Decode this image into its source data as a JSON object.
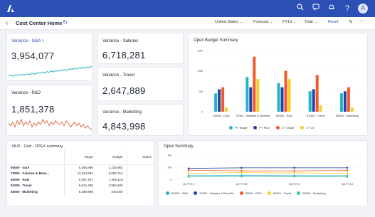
{
  "header": {
    "logo_icon": "anaplan-logo-icon",
    "icons": [
      "search-icon",
      "chat-icon",
      "bell-icon",
      "help-icon"
    ],
    "avatar_initials": "A"
  },
  "subbar": {
    "title": "Cost Center Home",
    "filters": [
      {
        "label": "United States"
      },
      {
        "label": "Forecast"
      },
      {
        "label": "FY19"
      },
      {
        "label": "Total"
      }
    ],
    "reset_label": "Reset"
  },
  "kpis": {
    "ga": {
      "title": "Variance - G&A >",
      "value": "3,954,077"
    },
    "rd": {
      "title": "Variance - R&D",
      "value": "1,851,378"
    },
    "salaries": {
      "title": "Variance - Salaries",
      "value": "6,718,281"
    },
    "travel": {
      "title": "Variance - Travel",
      "value": "2,647,889"
    },
    "marketing": {
      "title": "Variance - Marketing",
      "value": "4,843,998"
    }
  },
  "opex_budget": {
    "title": "Opex Budget Summary",
    "legend": [
      "PY Target",
      "PY Plan",
      "CY Target",
      "CY LE"
    ]
  },
  "grid": {
    "title": "NUX - Grid - OPEX summary",
    "columns": [
      "",
      "Target",
      "Budget",
      "Status"
    ],
    "rows": [
      [
        "60000 - G&A",
        "5,285,998",
        "1,335,962",
        ""
      ],
      [
        "70000 - Salaries & Bene...",
        "13,224,991",
        "6,506,714",
        ""
      ],
      [
        "80000 - R&D",
        "9,257,497",
        "7,406,119",
        ""
      ],
      [
        "81000 - Travel",
        "6,612,498",
        "3,964,609",
        ""
      ],
      [
        "83000 - Marketing",
        "5,289,998",
        "446,000",
        ""
      ]
    ]
  },
  "opex_summary": {
    "title": "Opex Summary",
    "legend": [
      "60000 - G&A",
      "70000 - Salaries & Benefits",
      "80000 - R&D",
      "81000 - Travel",
      "83000 - Marketing"
    ]
  },
  "colors": {
    "py_target": "#1fb5c9",
    "py_plan": "#2b3fa8",
    "cy_target": "#f05a28",
    "cy_le": "#f2d02a",
    "ga": "#1fb5c9",
    "salaries": "#2b3fa8",
    "rd": "#f05a28",
    "travel": "#f2d02a",
    "marketing": "#4ac29a"
  },
  "chart_data": [
    {
      "type": "bar",
      "title": "Opex Budget Summary",
      "categories": [
        "60000 - G&A",
        "70000 - Salaries & Benefits",
        "80000 - R&D",
        "81000 - Travel",
        "83000 - Marketing"
      ],
      "ytick_labels": [
        "0",
        "5M",
        "10M",
        "15M"
      ],
      "ylim": [
        0,
        15
      ],
      "series": [
        {
          "name": "PY Target",
          "values": [
            4.5,
            8.5,
            7.0,
            5.0,
            4.5
          ]
        },
        {
          "name": "PY Plan",
          "values": [
            5.5,
            6.0,
            6.0,
            5.5,
            5.0
          ]
        },
        {
          "name": "CY Target",
          "values": [
            6.0,
            13.5,
            10.0,
            9.0,
            6.0
          ]
        },
        {
          "name": "CY LE",
          "values": [
            1.0,
            8.0,
            8.0,
            1.5,
            1.0
          ]
        }
      ]
    },
    {
      "type": "line",
      "title": "Opex Summary",
      "categories": [
        "Q1 FY19",
        "Q2 FY19",
        "Q3 FY19",
        "Q4 FY19"
      ],
      "ytick_labels": [
        "0",
        "2M",
        "4M"
      ],
      "ylim": [
        0,
        4
      ],
      "series": [
        {
          "name": "60000 - G&A",
          "values": [
            0.6,
            0.65,
            0.6,
            0.6
          ]
        },
        {
          "name": "70000 - Salaries & Benefits",
          "values": [
            1.8,
            1.9,
            1.9,
            1.9
          ]
        },
        {
          "name": "80000 - R&D",
          "values": [
            1.5,
            1.4,
            1.4,
            1.45
          ]
        },
        {
          "name": "81000 - Travel",
          "values": [
            1.0,
            1.1,
            1.05,
            1.0
          ]
        },
        {
          "name": "83000 - Marketing",
          "values": [
            0.4,
            0.45,
            0.45,
            0.4
          ]
        }
      ]
    },
    {
      "type": "line",
      "title": "Variance - G&A >",
      "values": [
        42,
        44,
        41,
        45,
        43,
        46,
        44,
        47,
        45,
        48,
        46,
        50,
        47,
        49,
        52,
        50,
        54,
        51,
        55,
        53,
        57,
        54,
        58,
        56,
        60,
        57,
        62,
        59,
        61,
        64,
        62,
        66,
        63,
        67,
        65,
        69,
        66,
        70,
        68,
        72
      ]
    },
    {
      "type": "line",
      "title": "Variance - R&D",
      "values": [
        50,
        48,
        51,
        47,
        52,
        49,
        53,
        48,
        51,
        49,
        52,
        47,
        50,
        48,
        51,
        49,
        53,
        50,
        52,
        48,
        51,
        49,
        52,
        50,
        49,
        51,
        48,
        52,
        50,
        47,
        49,
        51,
        48,
        50,
        47,
        49,
        46,
        48,
        46,
        45
      ]
    }
  ]
}
